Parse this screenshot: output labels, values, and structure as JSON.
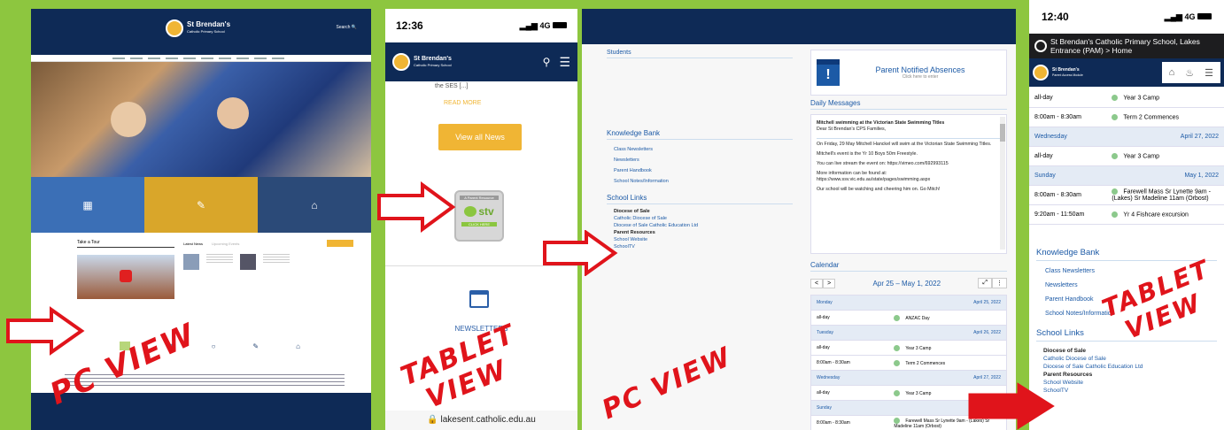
{
  "panel1": {
    "school_name": "St Brendan's",
    "school_sub": "Catholic Primary School",
    "search": "Search",
    "tab_tour": "Take a Tour",
    "tab_latest": "Latest News",
    "tab_upcoming": "Upcoming Events",
    "label": "PC VIEW"
  },
  "panel2": {
    "time": "12:36",
    "signal": "4G",
    "brand": "St Brendan's",
    "brand_sub": "Catholic Primary School",
    "ses": "the SES [...]",
    "read_more": "READ MORE",
    "view_all": "View all News",
    "stv_top": "A Parent Resource",
    "stv_logo": "stv",
    "stv_click": "CLICK HERE",
    "newsletters": "NEWSLETTERS",
    "url": "lakesent.catholic.edu.au",
    "label": "TABLET VIEW"
  },
  "panel3": {
    "students": "Students",
    "knowledge_bank": "Knowledge Bank",
    "kb_items": [
      "Class Newsletters",
      "Newsletters",
      "Parent Handbook",
      "School Notes/Information"
    ],
    "school_links": "School Links",
    "links": [
      "Diocese of Sale",
      "Catholic Diocese of Sale",
      "Diocese of Sale Catholic Education Ltd",
      "Parent Resources",
      "School Website",
      "SchoolTV"
    ],
    "absences_title": "Parent Notified Absences",
    "absences_sub": "Click here to enter",
    "daily_messages": "Daily Messages",
    "messages": [
      "Mitchell swimming at the Victorian State Swimming Titles",
      "Dear St Brendan's CPS Families,",
      "On Friday, 29 May Mitchell Hanckel will swim at the Victorian State Swimming Titles.",
      "Mitchell's event is the Yr 10 Boys 50m Freestyle.",
      "You can live stream the event on: https://vimeo.com/692993115",
      "More information can be found at: https://www.ssv.vic.edu.au/state/pages/swimming.aspx",
      "Our school will be watching and cheering him on. Go Mitch!"
    ],
    "calendar": "Calendar",
    "cal_range": "Apr 25 – May 1, 2022",
    "cal_rows": [
      {
        "type": "day",
        "left": "Monday",
        "right": "April 25, 2022"
      },
      {
        "type": "event",
        "left": "all-day",
        "right": "ANZAC Day"
      },
      {
        "type": "day",
        "left": "Tuesday",
        "right": "April 26, 2022"
      },
      {
        "type": "event",
        "left": "all-day",
        "right": "Year 3 Camp"
      },
      {
        "type": "event",
        "left": "8:00am - 8:30am",
        "right": "Term 2 Commences"
      },
      {
        "type": "day",
        "left": "Wednesday",
        "right": "April 27, 2022"
      },
      {
        "type": "event",
        "left": "all-day",
        "right": "Year 3 Camp"
      },
      {
        "type": "day",
        "left": "Sunday",
        "right": "May 1, 2022"
      },
      {
        "type": "event",
        "left": "8:00am - 8:30am",
        "right": "Farewell Mass Sr Lynette 9am - (Lakes) Sr Madeline 11am (Orbost)"
      }
    ],
    "label": "PC VIEW"
  },
  "panel4": {
    "time": "12:40",
    "signal": "4G",
    "banner": "St Brendan's Catholic Primary School, Lakes Entrance (PAM) > Home",
    "brand": "St Brendan's",
    "brand_sub": "Parent Access Module",
    "cal_rows": [
      {
        "type": "event",
        "left": "all-day",
        "right": "Year 3 Camp"
      },
      {
        "type": "event",
        "left": "8:00am - 8:30am",
        "right": "Term 2 Commences"
      },
      {
        "type": "day",
        "left": "Wednesday",
        "right": "April 27, 2022"
      },
      {
        "type": "event",
        "left": "all-day",
        "right": "Year 3 Camp"
      },
      {
        "type": "day",
        "left": "Sunday",
        "right": "May 1, 2022"
      },
      {
        "type": "event",
        "left": "8:00am - 8:30am",
        "right": "Farewell Mass Sr Lynette 9am - (Lakes) Sr Madeline 11am (Orbost)"
      },
      {
        "type": "event",
        "left": "9:20am - 11:50am",
        "right": "Yr 4 Fishcare excursion"
      }
    ],
    "knowledge_bank": "Knowledge Bank",
    "kb_items": [
      "Class Newsletters",
      "Newsletters",
      "Parent Handbook",
      "School Notes/Information"
    ],
    "school_links": "School Links",
    "links": [
      "Diocese of Sale",
      "Catholic Diocese of Sale",
      "Diocese of Sale Catholic Education Ltd",
      "Parent Resources",
      "School Website",
      "SchoolTV"
    ],
    "label": "TABLET VIEW"
  },
  "colors": {
    "green": "#8dc63f",
    "navy": "#0e2a56",
    "gold": "#f0b534",
    "red": "#e0141b"
  }
}
